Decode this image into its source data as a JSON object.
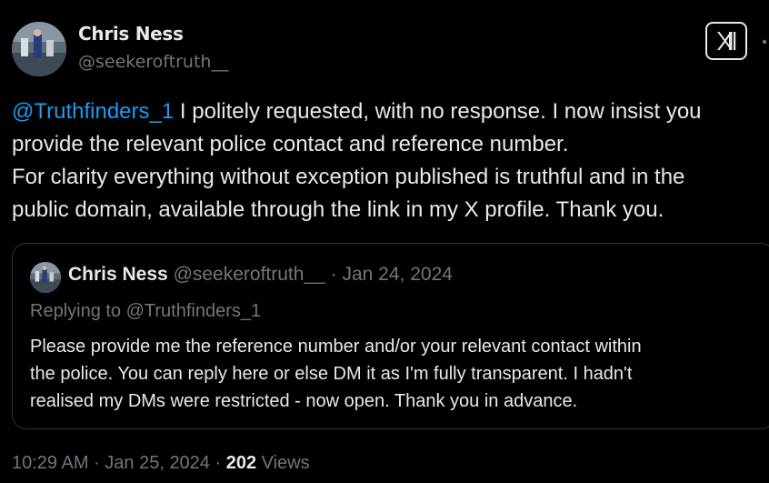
{
  "author": {
    "name": "Chris Ness",
    "handle": "@seekeroftruth__"
  },
  "tweet": {
    "mention": "@Truthfinders_1",
    "line1_rest": " I politely requested, with no response. I now insist you",
    "line2": "provide the relevant police contact and reference number.",
    "line3": "For clarity everything without exception published is truthful and in the",
    "line4": "public domain, available through the link in my X profile. Thank you."
  },
  "quoted": {
    "name": "Chris Ness",
    "handle": "@seekeroftruth__",
    "separator": " · ",
    "date": "Jan 24, 2024",
    "replying_to": "Replying to @Truthfinders_1",
    "line1": "Please provide me the reference number and/or your relevant contact within",
    "line2": "the police. You can reply here or else DM it as I'm fully transparent. I hadn't",
    "line3": "realised my DMs were restricted - now open. Thank you in advance."
  },
  "footer": {
    "time_date": "10:29 AM · Jan 25, 2024 · ",
    "views_count": "202",
    "views_label": " Views"
  },
  "colors": {
    "background": "#000000",
    "text": "#e7e9ea",
    "muted": "#71767b",
    "link": "#1d9bf0",
    "border": "#2f3336"
  },
  "icons": {
    "brand": "x-logo-icon",
    "menu": "more-dots-icon"
  }
}
